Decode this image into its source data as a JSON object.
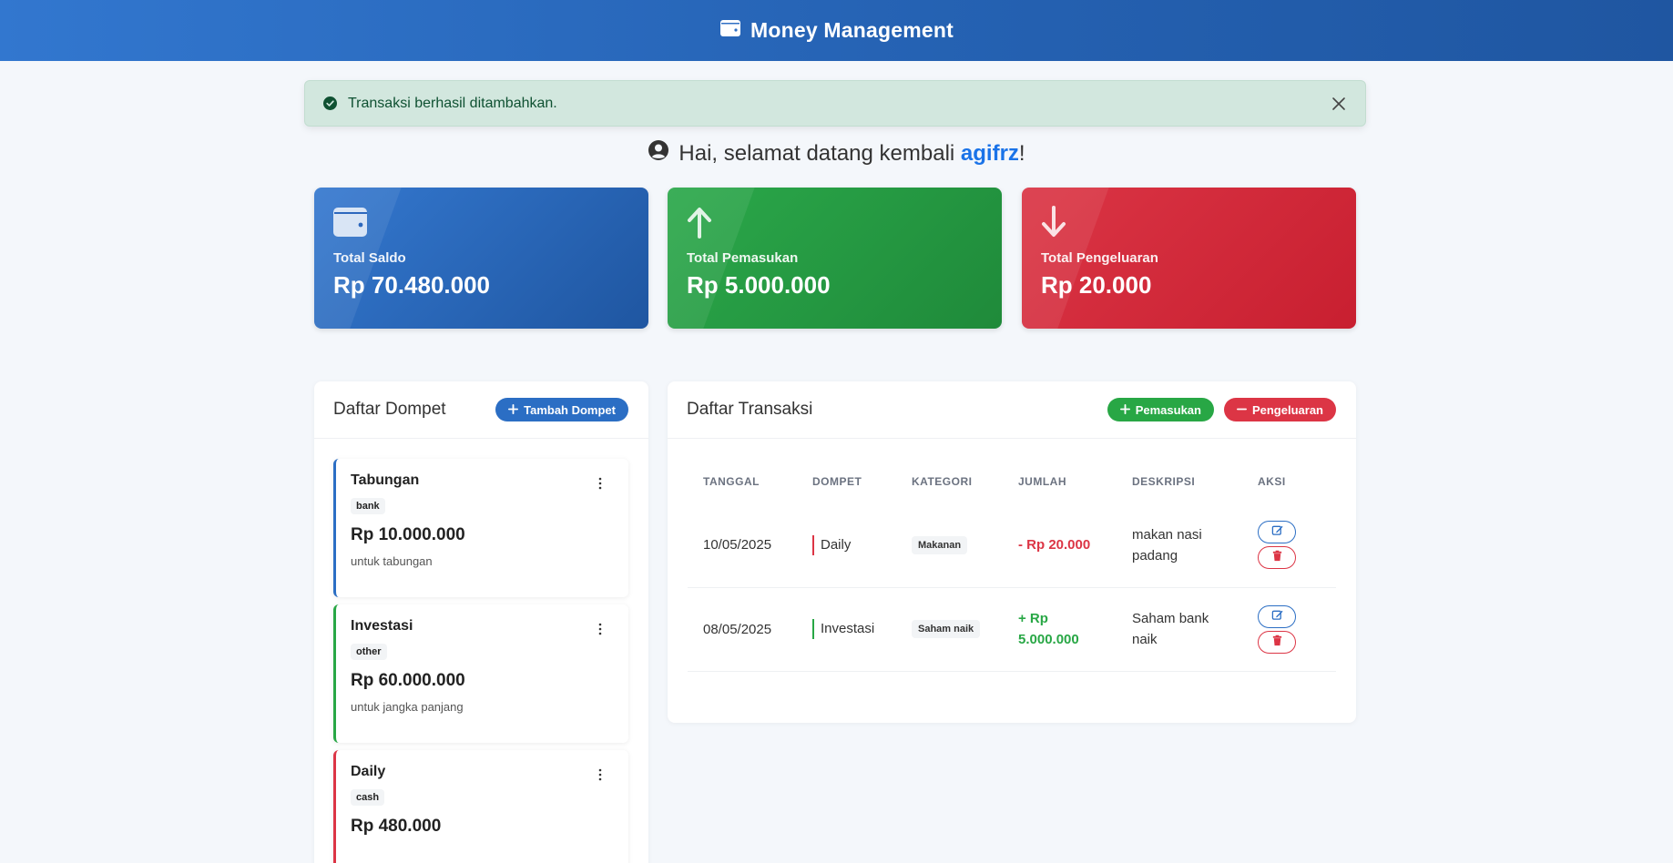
{
  "app": {
    "title": "Money Management",
    "icon": "wallet-icon"
  },
  "alert": {
    "message": "Transaksi berhasil ditambahkan.",
    "icon": "check-circle-icon"
  },
  "welcome": {
    "prefix": "Hai, selamat datang kembali ",
    "username": "agifrz",
    "suffix": "!"
  },
  "stats": [
    {
      "label": "Total Saldo",
      "value": "Rp 70.480.000",
      "icon": "wallet-icon",
      "color": "#2b6ec4"
    },
    {
      "label": "Total Pemasukan",
      "value": "Rp 5.000.000",
      "icon": "arrow-up-icon",
      "color": "#28a745"
    },
    {
      "label": "Total Pengeluaran",
      "value": "Rp 20.000",
      "icon": "arrow-down-icon",
      "color": "#dc3545"
    }
  ],
  "wallets": {
    "title": "Daftar Dompet",
    "add_label": "Tambah Dompet",
    "items": [
      {
        "name": "Tabungan",
        "type": "bank",
        "balance": "Rp 10.000.000",
        "description": "untuk tabungan",
        "color": "#2b6ec4"
      },
      {
        "name": "Investasi",
        "type": "other",
        "balance": "Rp 60.000.000",
        "description": "untuk jangka panjang",
        "color": "#28a745"
      },
      {
        "name": "Daily",
        "type": "cash",
        "balance": "Rp 480.000",
        "description": "",
        "color": "#dc3545"
      }
    ]
  },
  "transactions": {
    "title": "Daftar Transaksi",
    "income_label": "Pemasukan",
    "expense_label": "Pengeluaran",
    "columns": [
      "TANGGAL",
      "DOMPET",
      "KATEGORI",
      "JUMLAH",
      "DESKRIPSI",
      "AKSI"
    ],
    "rows": [
      {
        "date": "10/05/2025",
        "wallet": "Daily",
        "wallet_color": "#dc3545",
        "category": "Makanan",
        "amount": "- Rp 20.000",
        "kind": "expense",
        "description": "makan nasi padang"
      },
      {
        "date": "08/05/2025",
        "wallet": "Investasi",
        "wallet_color": "#28a745",
        "category": "Saham naik",
        "amount": "+ Rp 5.000.000",
        "kind": "income",
        "description": "Saham bank naik"
      }
    ]
  },
  "colors": {
    "primary": "#2b6ec4",
    "success": "#28a745",
    "danger": "#dc3545"
  }
}
